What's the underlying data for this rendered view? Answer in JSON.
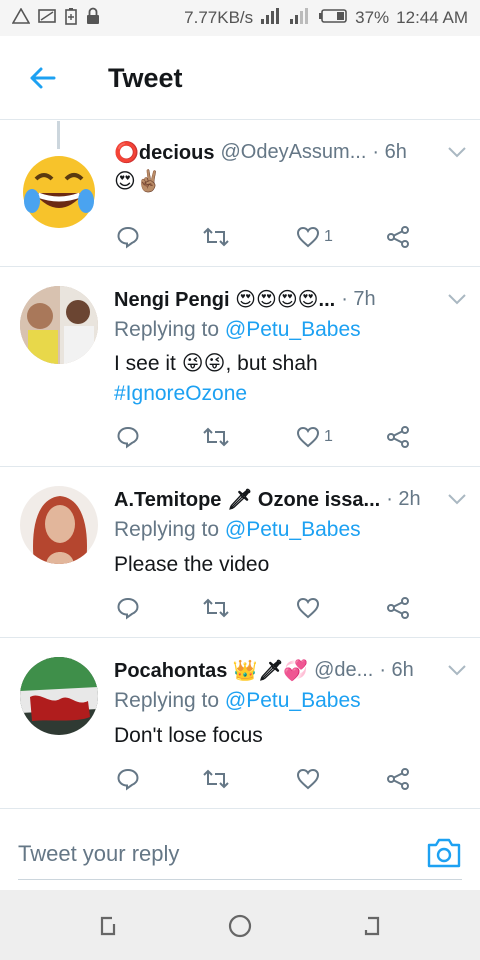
{
  "status_bar": {
    "speed": "7.77KB/s",
    "battery": "37%",
    "time": "12:44 AM"
  },
  "header": {
    "title": "Tweet"
  },
  "tweets": [
    {
      "name": "⭕decious",
      "handle": "@OdeyAssum...",
      "time": "· 6h",
      "text": "😍✌🏽",
      "likes": "1"
    },
    {
      "name": "Nengi Pengi 😍😍😍😍...",
      "time": "· 7h",
      "replying_prefix": "Replying to ",
      "replying_to": "@Petu_Babes",
      "text": "I see it 😜😜, but shah",
      "hashtag": "#IgnoreOzone",
      "likes": "1"
    },
    {
      "name": "A.Temitope 🗡 Ozone issa...",
      "time": "· 2h",
      "replying_prefix": "Replying to ",
      "replying_to": "@Petu_Babes",
      "text": "Please the video"
    },
    {
      "name": "Pocahontas 👑🗡💞",
      "handle": "@de...",
      "time": "· 6h",
      "replying_prefix": "Replying to ",
      "replying_to": "@Petu_Babes",
      "text": "Don't lose focus"
    }
  ],
  "reply_bar": {
    "placeholder": "Tweet your reply"
  },
  "colors": {
    "accent": "#1da1f2",
    "secondary_text": "#657786",
    "divider": "#e1e8ed"
  },
  "icons": {
    "back": "arrow-left-icon",
    "reply": "speech-bubble-icon",
    "retweet": "retweet-icon",
    "like": "heart-icon",
    "share": "share-icon",
    "camera": "camera-icon"
  }
}
